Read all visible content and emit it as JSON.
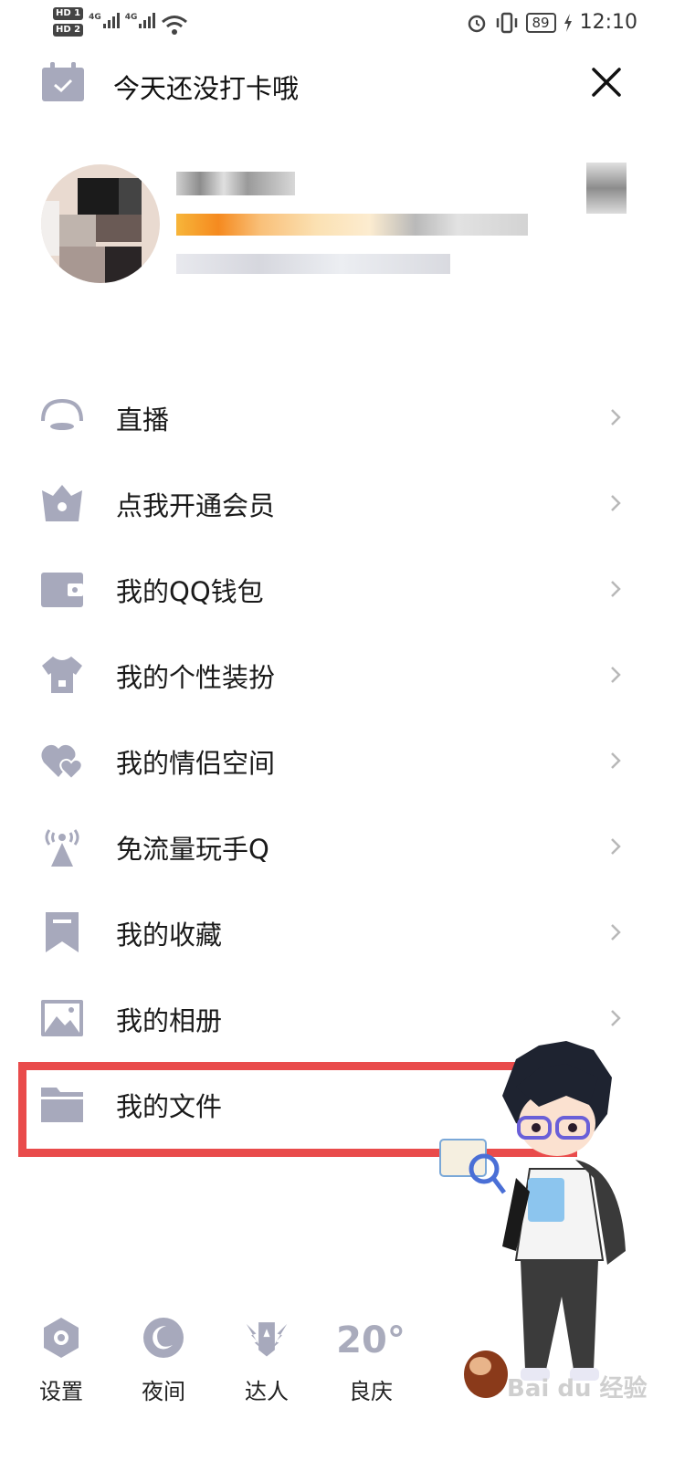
{
  "status_bar": {
    "sim1": "HD 1",
    "sim2": "HD 2",
    "network1": "4G",
    "network2": "4G",
    "battery": "89",
    "time": "12:10"
  },
  "header": {
    "checkin_text": "今天还没打卡哦"
  },
  "menu": {
    "items": [
      {
        "label": "直播",
        "icon": "live-icon"
      },
      {
        "label": "点我开通会员",
        "icon": "vip-crown-icon"
      },
      {
        "label": "我的QQ钱包",
        "icon": "wallet-icon"
      },
      {
        "label": "我的个性装扮",
        "icon": "tshirt-icon"
      },
      {
        "label": "我的情侣空间",
        "icon": "hearts-icon"
      },
      {
        "label": "免流量玩手Q",
        "icon": "signal-tower-icon"
      },
      {
        "label": "我的收藏",
        "icon": "bookmark-icon"
      },
      {
        "label": "我的相册",
        "icon": "photo-icon"
      },
      {
        "label": "我的文件",
        "icon": "folder-icon"
      }
    ]
  },
  "bottom_bar": {
    "settings": "设置",
    "night": "夜间",
    "expert": "达人",
    "weather_temp": "20°",
    "weather_city": "良庆"
  },
  "watermark": "Bai du 经验",
  "colors": {
    "icon_gray": "#a7a9bc",
    "highlight_red": "#e94b4b"
  }
}
